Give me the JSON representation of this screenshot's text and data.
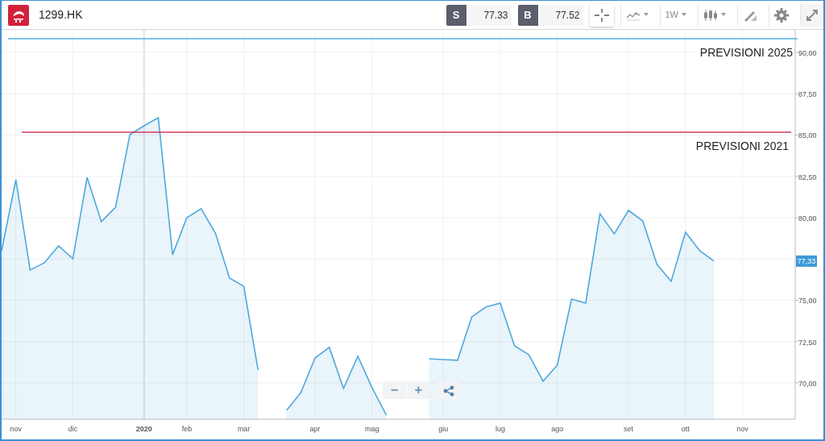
{
  "toolbar": {
    "logo": {
      "kind": "logo"
    },
    "symbol": "1299.HK",
    "quotes": [
      {
        "label": "S",
        "value": "77.33"
      },
      {
        "label": "B",
        "value": "77.52"
      }
    ],
    "tools": [
      {
        "kind": "crosshair",
        "selected": true,
        "dropdown": false
      },
      {
        "kind": "chart-type",
        "selected": false,
        "dropdown": true
      },
      {
        "kind": "interval",
        "label": "1W",
        "selected": false,
        "dropdown": true
      },
      {
        "kind": "candles",
        "selected": false,
        "dropdown": true
      },
      {
        "kind": "draw",
        "selected": false,
        "dropdown": false
      },
      {
        "kind": "settings",
        "selected": false,
        "dropdown": false
      },
      {
        "kind": "fullscreen",
        "selected": false,
        "dropdown": false
      }
    ]
  },
  "chart": {
    "last_price": "77,33",
    "chart_data": {
      "type": "area",
      "ylim": [
        67.8,
        91.27
      ],
      "grid": true,
      "categories": [
        null,
        "nov",
        null,
        null,
        null,
        "dic",
        null,
        null,
        null,
        null,
        "2020",
        null,
        null,
        "feb",
        null,
        null,
        null,
        "mar",
        null,
        null,
        null,
        null,
        "apr",
        null,
        null,
        null,
        "mag",
        null,
        null,
        null,
        null,
        "giu",
        null,
        null,
        null,
        "lug",
        null,
        null,
        null,
        "ago",
        null,
        null,
        null,
        null,
        "set",
        null,
        null,
        null,
        "ott",
        null,
        null,
        null,
        "nov",
        null,
        null,
        null
      ],
      "series": [
        {
          "color": "#4ea8dc",
          "values": [
            78.0,
            82.29,
            76.83,
            77.27,
            78.29,
            77.51,
            82.44,
            79.76,
            80.63,
            85.02,
            85.56,
            86.05,
            77.76,
            80.0,
            80.54,
            79.07,
            76.34,
            75.85,
            70.78,
            null,
            68.34,
            69.41,
            71.51,
            72.15,
            69.66,
            71.61,
            69.71,
            68.05,
            null,
            null,
            71.46,
            71.41,
            71.37,
            74.0,
            74.59,
            74.83,
            72.24,
            71.71,
            70.1,
            71.07,
            75.07,
            74.83,
            80.24,
            79.02,
            80.44,
            79.8,
            77.17,
            76.15,
            79.12,
            78.0,
            77.37,
            null,
            null,
            null,
            null,
            null
          ]
        }
      ],
      "yticks": [
        {
          "value": 70,
          "label": "70,00"
        },
        {
          "value": 72.5,
          "label": "72,50"
        },
        {
          "value": 75,
          "label": "75,00"
        },
        {
          "value": 80,
          "label": "80,00"
        },
        {
          "value": 82.5,
          "label": "82,50"
        },
        {
          "value": 85,
          "label": "85,00"
        },
        {
          "value": 87.5,
          "label": "87,50"
        },
        {
          "value": 90,
          "label": "90,00"
        }
      ],
      "ref_lines": [
        {
          "axis": "y",
          "value": 90.83,
          "color": "#4fb3e8",
          "label": "PREVISIONI 2025"
        },
        {
          "axis": "y",
          "value": 85.17,
          "color": "#d23a5c",
          "label": "PREVISIONI 2021"
        }
      ]
    },
    "controls": [
      {
        "kind": "zoom-out",
        "label": "−"
      },
      {
        "kind": "zoom-in",
        "label": "+"
      },
      {
        "kind": "share"
      }
    ]
  }
}
